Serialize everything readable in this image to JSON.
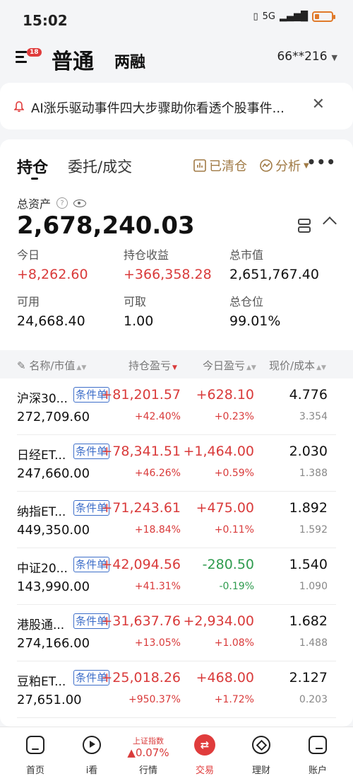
{
  "status_bar": {
    "time": "15:02",
    "network": "5G"
  },
  "header": {
    "menu_badge": "18",
    "mode_normal": "普通",
    "mode_margin": "两融",
    "account": "66**216"
  },
  "notice": {
    "text": "AI涨乐驱动事件四大步骤助你看透个股事件..."
  },
  "tabs": {
    "positions": "持仓",
    "orders": "委托/成交",
    "cleared": "已清仓",
    "analysis": "分析"
  },
  "summary": {
    "total_assets_label": "总资产",
    "total_assets": "2,678,240.03",
    "today_label": "今日",
    "today": "+8,262.60",
    "hold_pnl_label": "持仓收益",
    "hold_pnl": "+366,358.28",
    "market_value_label": "总市值",
    "market_value": "2,651,767.40",
    "available_label": "可用",
    "available": "24,668.40",
    "withdrawable_label": "可取",
    "withdrawable": "1.00",
    "position_ratio_label": "总仓位",
    "position_ratio": "99.01%"
  },
  "table": {
    "headers": {
      "name": "名称/市值",
      "hold_pnl": "持仓盈亏",
      "today_pnl": "今日盈亏",
      "price": "现价/成本"
    },
    "rows": [
      {
        "name": "沪深30...",
        "tag": "条件单",
        "market_value": "272,709.60",
        "hold_pnl": "+81,201.57",
        "hold_pnl_pct": "+42.40%",
        "today_pnl": "+628.10",
        "today_pnl_pct": "+0.23%",
        "price": "4.776",
        "cost": "3.354",
        "today_dir": "up"
      },
      {
        "name": "日经ET...",
        "tag": "条件单",
        "market_value": "247,660.00",
        "hold_pnl": "+78,341.51",
        "hold_pnl_pct": "+46.26%",
        "today_pnl": "+1,464.00",
        "today_pnl_pct": "+0.59%",
        "price": "2.030",
        "cost": "1.388",
        "today_dir": "up"
      },
      {
        "name": "纳指ET...",
        "tag": "条件单",
        "market_value": "449,350.00",
        "hold_pnl": "+71,243.61",
        "hold_pnl_pct": "+18.84%",
        "today_pnl": "+475.00",
        "today_pnl_pct": "+0.11%",
        "price": "1.892",
        "cost": "1.592",
        "today_dir": "up"
      },
      {
        "name": "中证20...",
        "tag": "条件单",
        "market_value": "143,990.00",
        "hold_pnl": "+42,094.56",
        "hold_pnl_pct": "+41.31%",
        "today_pnl": "-280.50",
        "today_pnl_pct": "-0.19%",
        "price": "1.540",
        "cost": "1.090",
        "today_dir": "down"
      },
      {
        "name": "港股通...",
        "tag": "条件单",
        "market_value": "274,166.00",
        "hold_pnl": "+31,637.76",
        "hold_pnl_pct": "+13.05%",
        "today_pnl": "+2,934.00",
        "today_pnl_pct": "+1.08%",
        "price": "1.682",
        "cost": "1.488",
        "today_dir": "up"
      },
      {
        "name": "豆粕ET...",
        "tag": "条件单",
        "market_value": "27,651.00",
        "hold_pnl": "+25,018.26",
        "hold_pnl_pct": "+950.37%",
        "today_pnl": "+468.00",
        "today_pnl_pct": "+1.72%",
        "price": "2.127",
        "cost": "0.203",
        "today_dir": "up"
      }
    ]
  },
  "bottom_nav": {
    "home": "首页",
    "watch": "i看",
    "index_title": "上证指数",
    "index_value": "▲0.07%",
    "market": "行情",
    "trade": "交易",
    "finance": "理财",
    "account": "账户"
  },
  "colors": {
    "up": "#d93a3a",
    "down": "#2e9b4e",
    "accent": "#a07a45",
    "trade": "#e03c3c"
  },
  "icons": [
    "menu-icon",
    "bell-icon",
    "close-icon",
    "chart-icon",
    "analysis-icon",
    "more-icon",
    "help-icon",
    "eye-icon",
    "list-toggle-icon",
    "collapse-icon",
    "home-icon",
    "watch-icon",
    "trade-icon",
    "finance-icon",
    "account-icon"
  ]
}
